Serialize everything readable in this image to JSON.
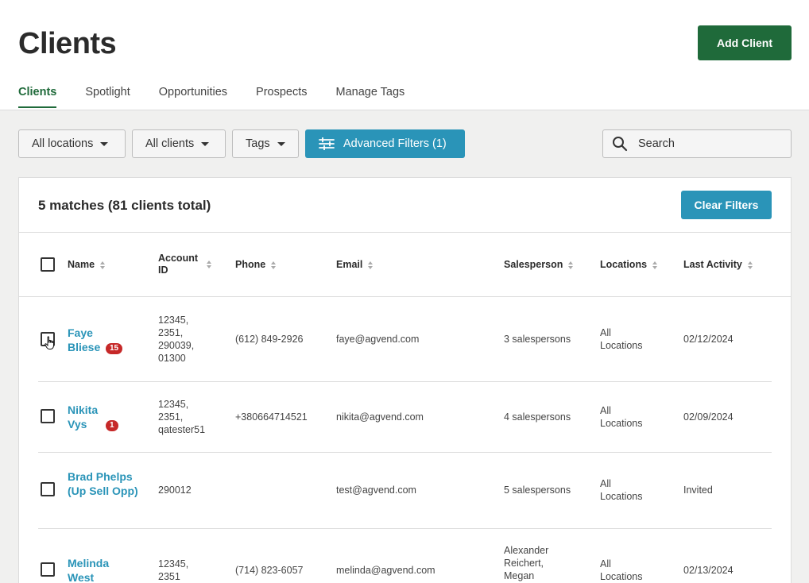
{
  "header": {
    "title": "Clients",
    "add_button": "Add Client",
    "tabs": [
      "Clients",
      "Spotlight",
      "Opportunities",
      "Prospects",
      "Manage Tags"
    ]
  },
  "filters": {
    "locations": "All locations",
    "clients": "All clients",
    "tags": "Tags",
    "advanced": "Advanced Filters (1)",
    "search_placeholder": "Search"
  },
  "results": {
    "summary": "5 matches (81 clients total)",
    "clear_button": "Clear Filters"
  },
  "table": {
    "columns": [
      "Name",
      "Account ID",
      "Phone",
      "Email",
      "Salesperson",
      "Locations",
      "Last Activity"
    ],
    "rows": [
      {
        "name": "Faye Bliese",
        "badge": "15",
        "account_id": "12345, 2351, 290039, 01300",
        "phone": "(612) 849-2926",
        "email": "faye@agvend.com",
        "salesperson": "3 salespersons",
        "locations": "All Locations",
        "last_activity": "02/12/2024"
      },
      {
        "name": "Nikita Vys",
        "badge": "1",
        "account_id": "12345, 2351, qatester51",
        "phone": "+380664714521",
        "email": "nikita@agvend.com",
        "salesperson": "4 salespersons",
        "locations": "All Locations",
        "last_activity": "02/09/2024"
      },
      {
        "name": "Brad Phelps (Up Sell Opp)",
        "badge": "",
        "account_id": "290012",
        "phone": "",
        "email": "test@agvend.com",
        "salesperson": "5 salespersons",
        "locations": "All Locations",
        "last_activity": "Invited"
      },
      {
        "name": "Melinda West",
        "badge": "",
        "account_id": "12345, 2351",
        "phone": "(714) 823-6057",
        "email": "melinda@agvend.com",
        "salesperson": "Alexander Reichert, Megan",
        "locations": "All Locations",
        "last_activity": "02/13/2024"
      }
    ]
  },
  "colors": {
    "brand_green": "#1f6a3a",
    "accent_blue": "#2a94b8",
    "badge_red": "#c62828"
  }
}
